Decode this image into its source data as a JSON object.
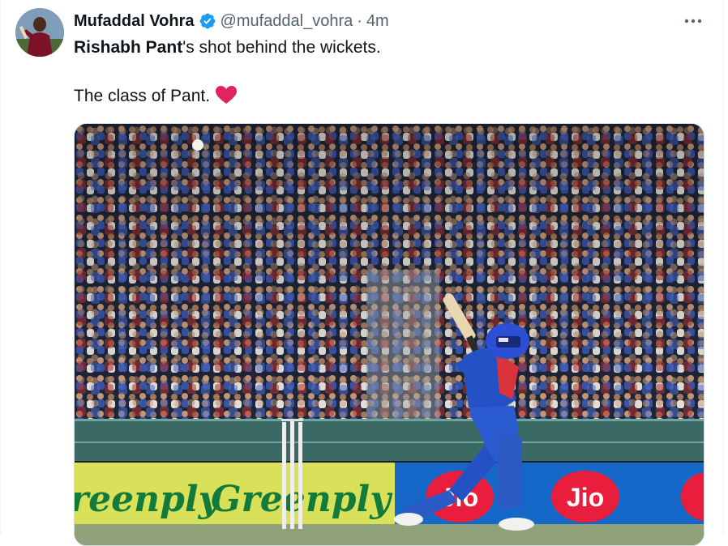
{
  "author": {
    "display_name": "Mufaddal Vohra",
    "handle": "@mufaddal_vohra",
    "separator": "·",
    "time_ago": "4m",
    "verified_color": "#1d9bf0"
  },
  "tweet": {
    "name_bold": "Rishabh Pant",
    "line1_rest": "'s shot behind the wickets.",
    "line2": "The class of Pant.",
    "emoji": "red-heart"
  },
  "media": {
    "ad_boards": [
      "reenply",
      "Greenply",
      "Jio",
      "Jio"
    ]
  },
  "icons": {
    "more": "more-horizontal-icon",
    "verified": "verified-badge-icon"
  },
  "colors": {
    "text_primary": "#0f1419",
    "text_secondary": "#536471",
    "heart": "#f91880"
  }
}
